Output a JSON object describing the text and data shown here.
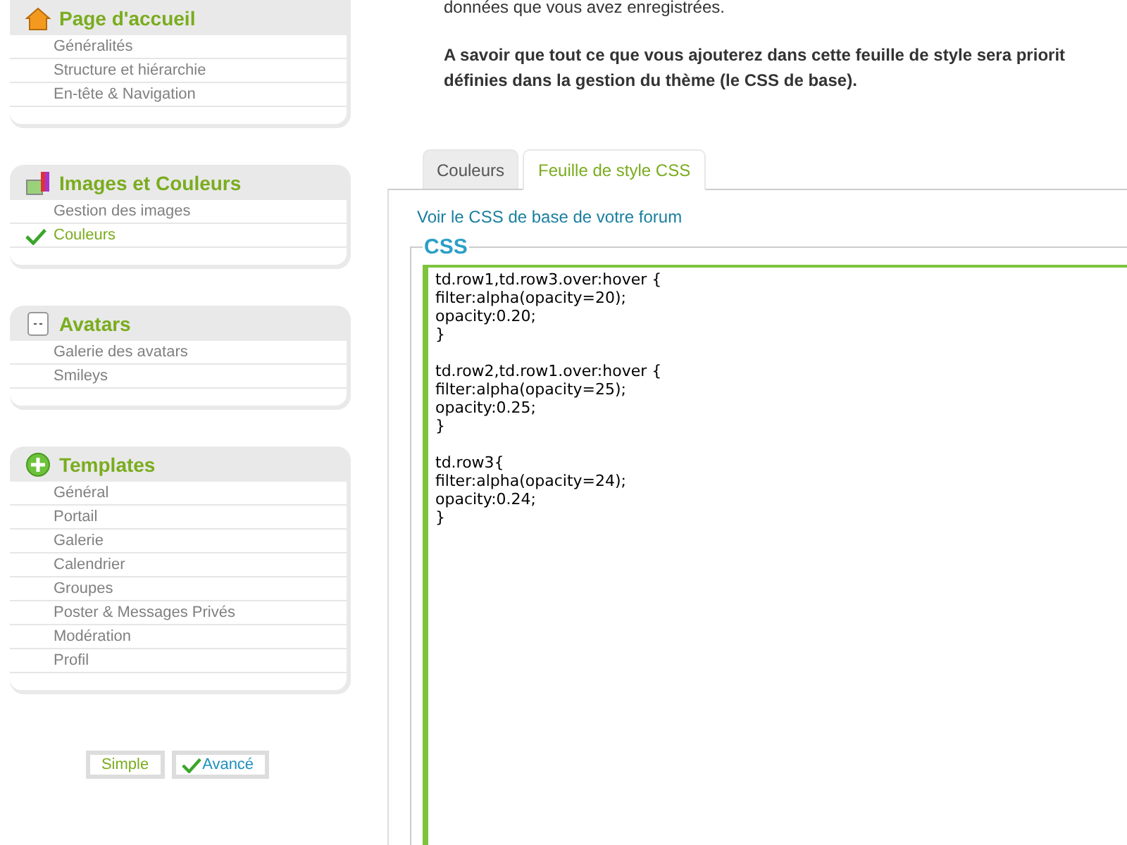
{
  "sidebar": {
    "panels": [
      {
        "title": "Page d'accueil",
        "items": [
          {
            "label": "Généralités",
            "selected": false
          },
          {
            "label": "Structure et hiérarchie",
            "selected": false
          },
          {
            "label": "En-tête & Navigation",
            "selected": false
          }
        ]
      },
      {
        "title": "Images et Couleurs",
        "items": [
          {
            "label": "Gestion des images",
            "selected": false
          },
          {
            "label": "Couleurs",
            "selected": true
          }
        ]
      },
      {
        "title": "Avatars",
        "items": [
          {
            "label": "Galerie des avatars",
            "selected": false
          },
          {
            "label": "Smileys",
            "selected": false
          }
        ]
      },
      {
        "title": "Templates",
        "items": [
          {
            "label": "Général",
            "selected": false
          },
          {
            "label": "Portail",
            "selected": false
          },
          {
            "label": "Galerie",
            "selected": false
          },
          {
            "label": "Calendrier",
            "selected": false
          },
          {
            "label": "Groupes",
            "selected": false
          },
          {
            "label": "Poster & Messages Privés",
            "selected": false
          },
          {
            "label": "Modération",
            "selected": false
          },
          {
            "label": "Profil",
            "selected": false
          }
        ]
      }
    ],
    "modes": [
      {
        "label": "Simple",
        "selected": false
      },
      {
        "label": "Avancé",
        "selected": true
      }
    ]
  },
  "intro": {
    "lines": [
      "données que vous avez enregistrées."
    ],
    "notice": [
      "A savoir que tout ce que vous ajouterez dans cette feuille de style sera priorit",
      "définies dans la gestion du thème (le CSS de base)."
    ]
  },
  "tabs": [
    {
      "label": "Couleurs",
      "selected": false
    },
    {
      "label": "Feuille de style CSS",
      "selected": true
    }
  ],
  "base_css_link": "Voir le CSS de base de votre forum",
  "css_fieldset": {
    "legend": "CSS",
    "value": "td.row1,td.row3.over:hover {\nfilter:alpha(opacity=20);\nopacity:0.20;\n}\n\ntd.row2,td.row1.over:hover {\nfilter:alpha(opacity=25);\nopacity:0.25;\n}\n\ntd.row3{\nfilter:alpha(opacity=24);\nopacity:0.24;\n}"
  }
}
